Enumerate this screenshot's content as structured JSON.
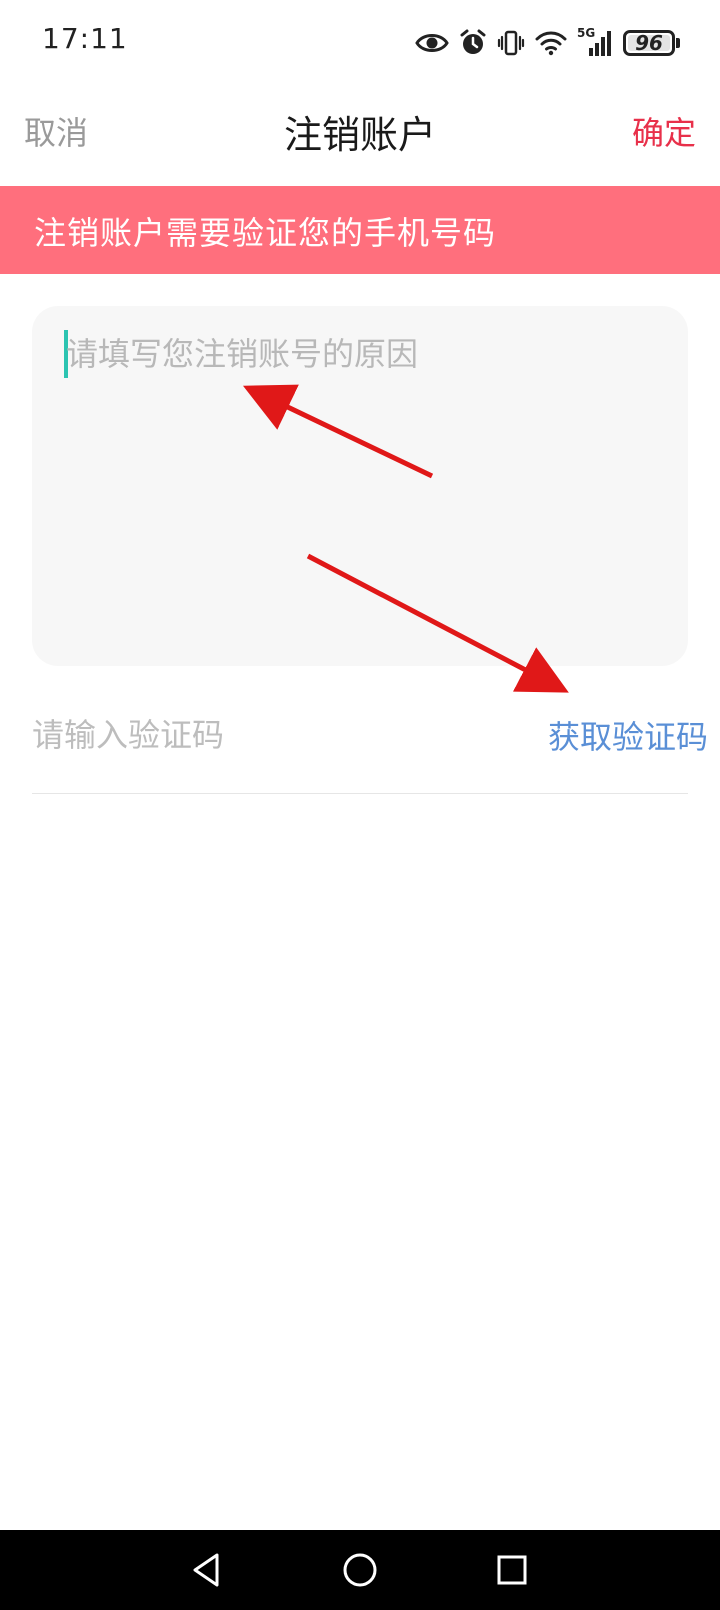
{
  "status_bar": {
    "time": "17:11",
    "network": "5G",
    "battery": "96",
    "icons": [
      "eye-icon",
      "alarm-icon",
      "vibrate-icon",
      "wifi-icon",
      "signal-icon",
      "battery-icon"
    ]
  },
  "header": {
    "cancel_label": "取消",
    "title": "注销账户",
    "confirm_label": "确定"
  },
  "notice": {
    "text": "注销账户需要验证您的手机号码"
  },
  "form": {
    "reason_placeholder": "请填写您注销账号的原因",
    "reason_value": "",
    "code_placeholder": "请输入验证码",
    "code_value": "",
    "get_code_label": "获取验证码"
  },
  "colors": {
    "accent_red": "#e8304a",
    "banner_bg": "#ff6f7d",
    "link_blue": "#5a8fd6",
    "caret": "#2cc4b1",
    "annotation_arrow": "#e01818"
  },
  "system_nav": {
    "icons": [
      "back-icon",
      "home-icon",
      "recents-icon"
    ]
  }
}
